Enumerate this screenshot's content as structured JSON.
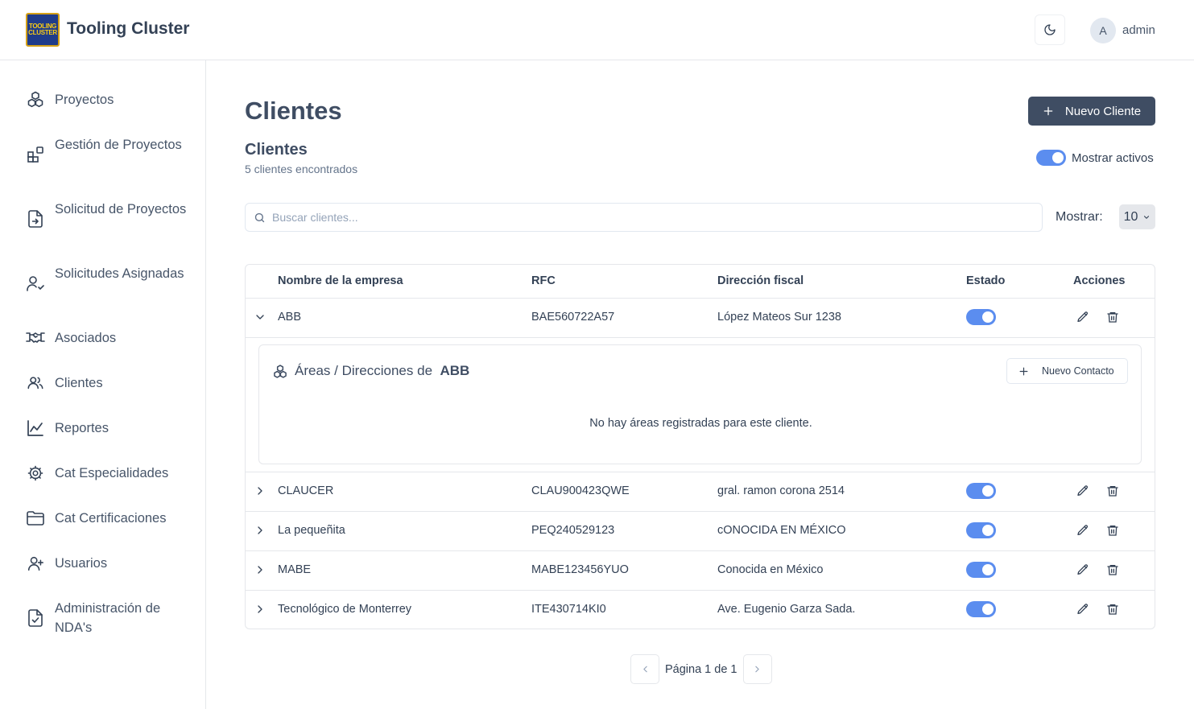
{
  "app": {
    "logo_line1": "TOOLING",
    "logo_line2": "CLUSTER",
    "title": "Tooling Cluster"
  },
  "header": {
    "avatar_initial": "A",
    "user_name": "admin",
    "theme_icon": "moon-icon"
  },
  "sidebar": {
    "items": [
      {
        "label": "Proyectos",
        "icon": "boxes-icon"
      },
      {
        "label": "Gestión de Proyectos",
        "icon": "blocks-icon"
      },
      {
        "label": "Solicitud de Proyectos",
        "icon": "file-input-icon"
      },
      {
        "label": "Solicitudes Asignadas",
        "icon": "user-check-icon"
      },
      {
        "label": "Asociados",
        "icon": "handshake-icon"
      },
      {
        "label": "Clientes",
        "icon": "users-icon"
      },
      {
        "label": "Reportes",
        "icon": "chart-line-icon"
      },
      {
        "label": "Cat Especialidades",
        "icon": "cog-icon"
      },
      {
        "label": "Cat Certificaciones",
        "icon": "folder-icon"
      },
      {
        "label": "Usuarios",
        "icon": "user-plus-icon"
      },
      {
        "label": "Administración de NDA's",
        "icon": "file-check-icon"
      }
    ]
  },
  "main": {
    "page_title": "Clientes",
    "new_client_label": "Nuevo Cliente",
    "section_title": "Clientes",
    "section_subtitle": "5 clientes encontrados",
    "show_active_label": "Mostrar activos",
    "search_placeholder": "Buscar clientes...",
    "show_label": "Mostrar:",
    "page_size": "10"
  },
  "table": {
    "columns": [
      "Nombre de la empresa",
      "RFC",
      "Dirección fiscal",
      "Estado",
      "Acciones"
    ],
    "rows": [
      {
        "name": "ABB",
        "rfc": "BAE560722A57",
        "address": "López Mateos Sur 1238",
        "active": true,
        "expanded": true
      },
      {
        "name": "CLAUCER",
        "rfc": "CLAU900423QWE",
        "address": "gral. ramon corona 2514",
        "active": true,
        "expanded": false
      },
      {
        "name": "La pequeñita",
        "rfc": "PEQ240529123",
        "address": "cONOCIDA EN MÉXICO",
        "active": true,
        "expanded": false
      },
      {
        "name": "MABE",
        "rfc": "MABE123456YUO",
        "address": "Conocida en México",
        "active": true,
        "expanded": false
      },
      {
        "name": "Tecnológico de Monterrey",
        "rfc": "ITE430714KI0",
        "address": "Ave. Eugenio Garza Sada.",
        "active": true,
        "expanded": false
      }
    ],
    "areas": {
      "title_prefix": "Áreas / Direcciones de",
      "client_name": "ABB",
      "new_contact_label": "Nuevo Contacto",
      "empty_message": "No hay áreas registradas para este cliente."
    }
  },
  "pagination": {
    "text": "Página 1 de 1"
  },
  "colors": {
    "primary": "#3f4d63",
    "toggle_on": "#5b8def",
    "border": "#e5e7eb"
  }
}
